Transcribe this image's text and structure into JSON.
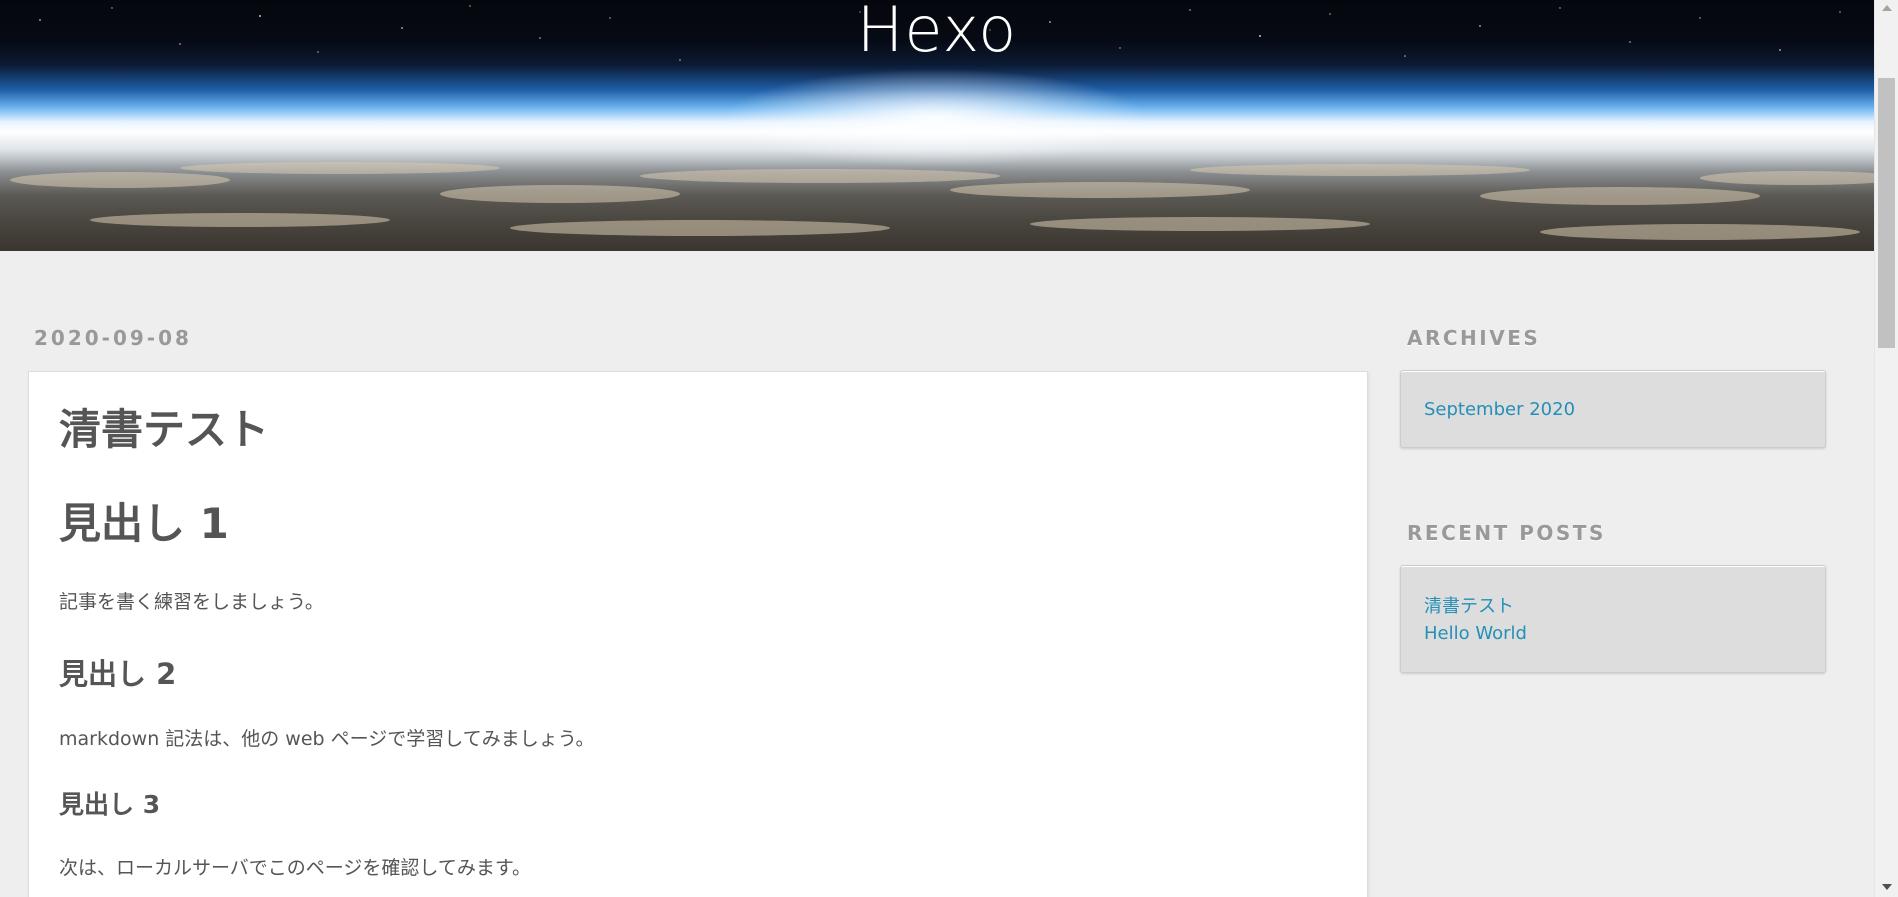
{
  "site": {
    "title": "Hexo"
  },
  "article": {
    "date": "2020-09-08",
    "title": "清書テスト",
    "content": {
      "heading1": "見出し 1",
      "paragraph1": "記事を書く練習をしましょう。",
      "heading2": "見出し 2",
      "paragraph2": "markdown 記法は、他の web ページで学習してみましょう。",
      "heading3": "見出し 3",
      "paragraph3": "次は、ローカルサーバでこのページを確認してみます。"
    }
  },
  "sidebar": {
    "archives": {
      "title": "ARCHIVES",
      "items": [
        {
          "label": "September 2020"
        }
      ]
    },
    "recent_posts": {
      "title": "RECENT POSTS",
      "items": [
        {
          "label": "清書テスト"
        },
        {
          "label": "Hello World"
        }
      ]
    }
  },
  "colors": {
    "background": "#eeeeee",
    "link": "#258fb8",
    "text": "#555555",
    "muted": "#999999"
  }
}
